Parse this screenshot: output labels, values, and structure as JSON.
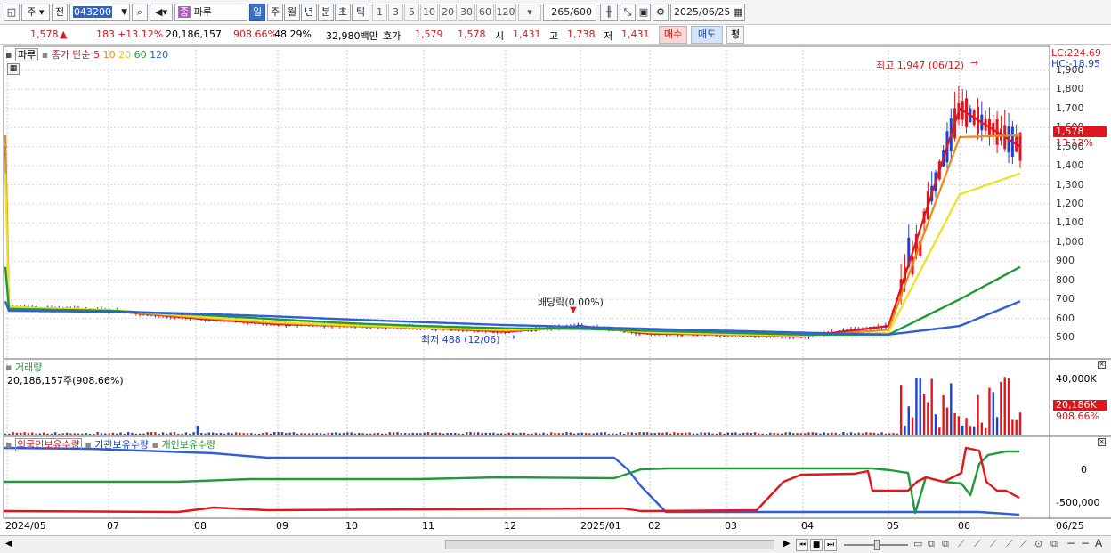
{
  "toolbar": {
    "market_type": "주",
    "prev_label": "전",
    "stock_code": "043200",
    "stock_badge": "종",
    "stock_name": "파루",
    "periods": [
      "일",
      "주",
      "월",
      "년",
      "분",
      "초",
      "틱"
    ],
    "active_period": "일",
    "intervals": [
      "1",
      "3",
      "5",
      "10",
      "20",
      "30",
      "60",
      "120"
    ],
    "count": "265",
    "count_max": "/600",
    "date": "2025/06/25"
  },
  "quote": {
    "price": "1,578",
    "change": "183",
    "change_pct": "+13.12%",
    "volume": "20,186,157",
    "volume_ratio": "908.66%",
    "turnover": "48.29%",
    "amount": "32,980백만",
    "hoga_label": "호가",
    "ask": "1,579",
    "bid": "1,578",
    "open_label": "시",
    "open": "1,431",
    "high_label": "고",
    "high": "1,738",
    "low_label": "저",
    "low": "1,431",
    "buy_label": "매수",
    "sell_label": "매도",
    "eval_label": "평"
  },
  "price_pane": {
    "legend_name": "파루",
    "legend_close": "종가 단순",
    "ma_periods": [
      "5",
      "10",
      "20",
      "60",
      "120"
    ],
    "lc": "LC:224.69",
    "hc": "HC:-18.95",
    "high_note": "최고 1,947 (06/12)",
    "low_note": "최저 488 (12/06)",
    "dividend_note": "배당락(0.00%)",
    "current_price_tag": "1,578",
    "current_pct_tag": "13.12%",
    "y_ticks": [
      "1,900",
      "1,800",
      "1,700",
      "1,600",
      "1,500",
      "1,400",
      "1,300",
      "1,200",
      "1,100",
      "1,000",
      "900",
      "800",
      "700",
      "600",
      "500"
    ]
  },
  "volume_pane": {
    "title": "거래량",
    "value": "20,186,157주(908.66%)",
    "tick": "40,000K",
    "current_tag": "20,186K",
    "current_pct": "908.66%"
  },
  "holding_pane": {
    "legend_foreign": "외국인보유수량",
    "legend_inst": "기관보유수량",
    "legend_indiv": "개인보유수량",
    "ticks": [
      "0",
      "-500,000"
    ]
  },
  "x_axis": [
    "2024/05",
    "07",
    "08",
    "09",
    "10",
    "11",
    "12",
    "2025/01",
    "02",
    "03",
    "04",
    "05",
    "06",
    "06/25"
  ],
  "colors": {
    "up": "#e0161c",
    "down": "#1d40d6",
    "ma5": "#e0161c",
    "ma10": "#f08a12",
    "ma20": "#f2e01a",
    "ma60": "#1f9a3a",
    "ma120": "#2f5fd8"
  },
  "chart_data": {
    "type": "line",
    "title": "",
    "y_range": [
      450,
      1950
    ],
    "months": [
      "2024/05",
      "07",
      "08",
      "09",
      "10",
      "11",
      "12",
      "2025/01",
      "02",
      "03",
      "04",
      "05",
      "06"
    ],
    "series": [
      {
        "name": "5",
        "values": [
          660,
          640,
          600,
          570,
          560,
          550,
          530,
          560,
          520,
          515,
          505,
          560,
          1700,
          1500
        ]
      },
      {
        "name": "10",
        "values": [
          660,
          640,
          605,
          575,
          560,
          550,
          535,
          555,
          525,
          515,
          508,
          540,
          1550,
          1560
        ]
      },
      {
        "name": "20",
        "values": [
          660,
          645,
          610,
          580,
          565,
          552,
          540,
          550,
          528,
          518,
          510,
          525,
          1250,
          1360
        ]
      },
      {
        "name": "60",
        "values": [
          650,
          640,
          620,
          595,
          575,
          560,
          548,
          545,
          535,
          525,
          515,
          515,
          700,
          870
        ]
      },
      {
        "name": "120",
        "values": [
          640,
          635,
          625,
          610,
          595,
          580,
          565,
          555,
          545,
          535,
          525,
          515,
          560,
          690
        ]
      }
    ]
  }
}
